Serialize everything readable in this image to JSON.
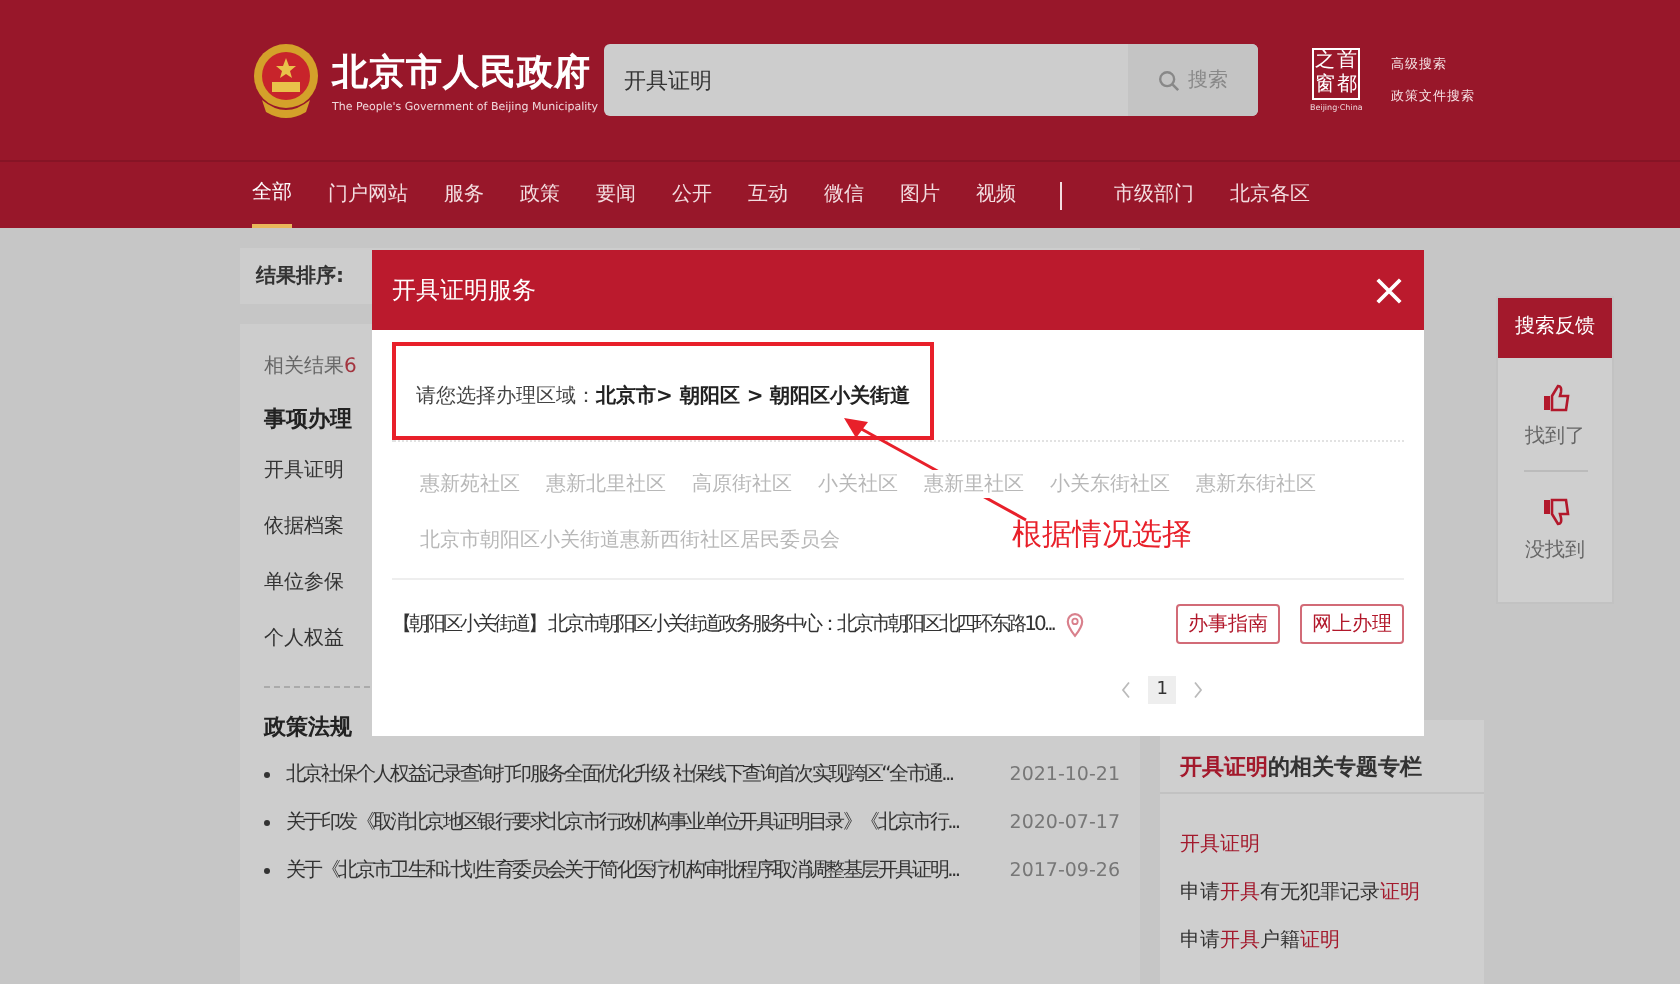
{
  "header": {
    "site_name": "北京市人民政府",
    "site_subtitle": "The People's Government of Beijing Municipality",
    "search": {
      "value": "开具证明",
      "button": "搜索"
    },
    "portal_logo": {
      "chars": [
        "之",
        "首",
        "窗",
        "都"
      ],
      "caption": "Beijing·China"
    },
    "links": [
      "高级搜索",
      "政策文件搜索"
    ]
  },
  "nav": {
    "primary": [
      {
        "label": "全部",
        "selected": true
      },
      {
        "label": "门户网站",
        "selected": false
      },
      {
        "label": "服务",
        "selected": false
      },
      {
        "label": "政策",
        "selected": false
      },
      {
        "label": "要闻",
        "selected": false
      },
      {
        "label": "公开",
        "selected": false
      },
      {
        "label": "互动",
        "selected": false
      },
      {
        "label": "微信",
        "selected": false
      },
      {
        "label": "图片",
        "selected": false
      },
      {
        "label": "视频",
        "selected": false
      }
    ],
    "secondary": [
      {
        "label": "市级部门",
        "selected": false
      },
      {
        "label": "北京各区",
        "selected": false
      }
    ]
  },
  "sort_bar": {
    "label": "结果排序:"
  },
  "results": {
    "label": "相关结果",
    "count": "6"
  },
  "services": {
    "title": "事项办理",
    "items": [
      "开具证明",
      "依据档案",
      "单位参保",
      "个人权益"
    ]
  },
  "policies": {
    "title": "政策法规",
    "items": [
      {
        "title": "北京社保个人权益记录查询打印服务全面优化升级 社保线下查询首次实现跨区“全市通...",
        "date": "2021-10-21"
      },
      {
        "title": "关于印发《取消北京地区银行要求北京市行政机构事业单位开具证明目录》《北京市行...",
        "date": "2020-07-17"
      },
      {
        "title": "关于《北京市卫生和计划生育委员会关于简化医疗机构审批程序取消调整基层开具证明...",
        "date": "2017-09-26"
      }
    ]
  },
  "topics": {
    "title": "**开具证明**的相关专题专栏",
    "items": [
      {
        "text": "开具证明",
        "highlighted": true
      },
      {
        "text": "申请**开具**有无犯罪记录**证明**",
        "highlighted": false
      },
      {
        "text": "申请**开具**户籍**证明**",
        "highlighted": false
      }
    ]
  },
  "modal": {
    "title": "开具证明服务",
    "region": {
      "label": "请您选择办理区域：",
      "path": "北京市> 朝阳区 > 朝阳区小关街道"
    },
    "communities": [
      "惠新苑社区",
      "惠新北里社区",
      "高原街社区",
      "小关社区",
      "惠新里社区",
      "小关东街社区",
      "惠新东街社区",
      "北京市朝阳区小关街道惠新西街社区居民委员会"
    ],
    "service_point": {
      "text": "【朝阳区小关街道】 北京市朝阳区小关街道政务服务中心：北京市朝阳区北四环东路10...",
      "buttons": [
        "办事指南",
        "网上办理"
      ]
    },
    "pagination": {
      "pages": [
        {
          "label": "1",
          "selected": true
        }
      ]
    }
  },
  "annotation": {
    "text": "根据情况选择"
  },
  "feedback": {
    "title": "搜索反馈",
    "options": [
      {
        "label": "找到了",
        "kind": "up"
      },
      {
        "label": "没找到",
        "kind": "down"
      }
    ]
  }
}
